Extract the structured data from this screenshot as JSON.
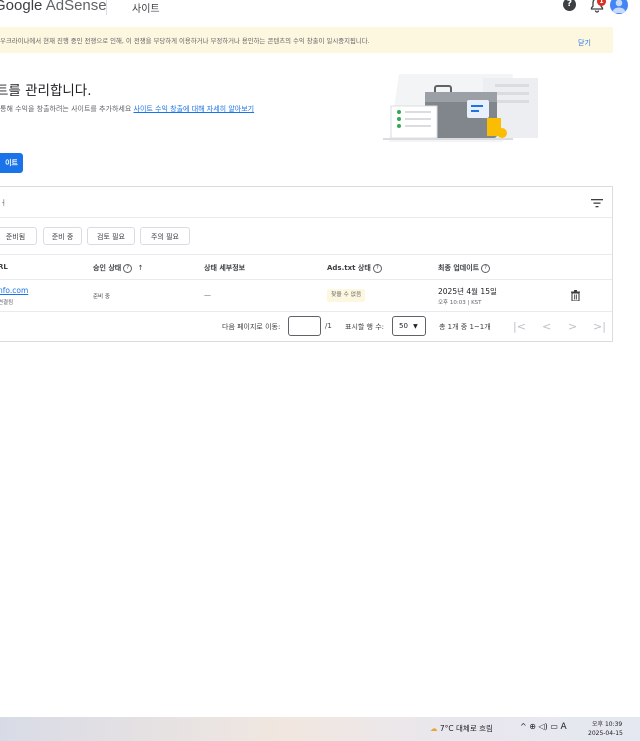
{
  "header": {
    "logo_google": "Google",
    "logo_product": "AdSense",
    "page": "사이트"
  },
  "banner": {
    "text": "우크라이나에서 현재 진행 중인 전쟁으로 인해, 이 전쟁을 부당하게 이용하거나 부정하거나 용인하는 콘텐츠의 수익 창출이 일시중지됩니다.",
    "close": "닫기"
  },
  "main": {
    "heading": "트를 관리합니다.",
    "subtitle_prefix": "통해 수익을 창출하려는 사이트를 추가하세요",
    "subtitle_link": "사이트 수익 창출에 대해 자세히 알아보기",
    "add_button": "이트"
  },
  "table": {
    "search_placeholder": "ㅓ",
    "chips": [
      "준비됨",
      "준비 중",
      "검토 필요",
      "주의 필요"
    ],
    "columns": {
      "url": "RL",
      "approval": "승인 상태",
      "details": "상태 세부정보",
      "ads_txt": "Ads.txt 상태",
      "updated": "최종 업데이트"
    },
    "rows": [
      {
        "site": "nfo.com",
        "site_sub": "연결됨",
        "approval": "준비 중",
        "details": "—",
        "ads_txt": "찾을 수 없음",
        "date": "2025년 4월 15일",
        "time": "오후 10:03 | KST"
      }
    ]
  },
  "pagination": {
    "goto_label": "다음 페이지로 이동:",
    "total_pages": "/1",
    "rows_label": "표시할 행 수:",
    "rows_value": "50",
    "summary": "총 1개 중 1~1개"
  },
  "taskbar": {
    "weather": "7°C  대체로 흐림",
    "time": "오후 10:39",
    "date": "2025-04-15",
    "ime": "A"
  },
  "colors": {
    "accent": "#1a73e8",
    "banner_bg": "#fef7e0",
    "notification": "#d93025"
  }
}
